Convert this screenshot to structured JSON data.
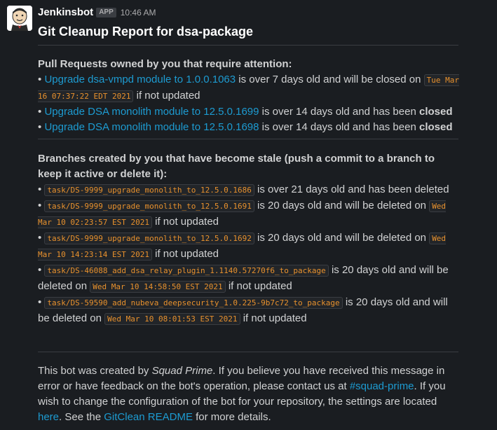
{
  "message": {
    "sender": "Jenkinsbot",
    "badge": "APP",
    "time": "10:46 AM",
    "title": "Git Cleanup Report for dsa-package"
  },
  "pull_requests": {
    "heading": "Pull Requests owned by you that require attention:",
    "items": [
      {
        "bullet": "•",
        "link": "Upgrade dsa-vmpd module to 1.0.0.1063",
        "text1": " is over 7 days old and will be closed on ",
        "date": "Tue Mar 16 07:37:22 EDT 2021",
        "text2": " if not updated"
      },
      {
        "bullet": "•",
        "link": "Upgrade DSA monolith module to 12.5.0.1699",
        "text1": " is over 14 days old and has been ",
        "bold": "closed"
      },
      {
        "bullet": "•",
        "link": "Upgrade DSA monolith module to 12.5.0.1698",
        "text1": " is over 14 days old and has been ",
        "bold": "closed"
      }
    ]
  },
  "branches": {
    "heading": "Branches created by you that have become stale (push a commit to a branch to keep it active or delete it):",
    "items": [
      {
        "bullet": "•",
        "branch": "task/DS-9999_upgrade_monolith_to_12.5.0.1686",
        "text1": " is over 21 days old and has been deleted"
      },
      {
        "bullet": "•",
        "branch": "task/DS-9999_upgrade_monolith_to_12.5.0.1691",
        "text1": " is 20 days old and will be deleted on ",
        "date": "Wed Mar 10 02:23:57 EST 2021",
        "text2": " if not updated"
      },
      {
        "bullet": "•",
        "branch": "task/DS-9999_upgrade_monolith_to_12.5.0.1692",
        "text1": " is 20 days old and will be deleted on ",
        "date": "Wed Mar 10 14:23:14 EST 2021",
        "text2": " if not updated"
      },
      {
        "bullet": "•",
        "branch": "task/DS-46088_add_dsa_relay_plugin_1.1140.57270f6_to_package",
        "text1": " is 20 days old and will be deleted on ",
        "date": "Wed Mar 10 14:58:50 EST 2021",
        "text2": " if not updated"
      },
      {
        "bullet": "•",
        "branch": "task/DS-59590_add_nubeva_deepsecurity_1.0.225-9b7c72_to_package",
        "text1": " is 20 days old and will be deleted on ",
        "date": "Wed Mar 10 08:01:53 EST 2021",
        "text2": " if not updated"
      }
    ]
  },
  "footer": {
    "t1": "This bot was created by ",
    "italic": "Squad Prime",
    "t2": ". If you believe you have received this message in error or have feedback on the bot's operation, please contact us at ",
    "channel": "#squad-prime",
    "t3": ". If you wish to change the configuration of the bot for your repository, the settings are located ",
    "here": "here",
    "t4": ". See the ",
    "readme": "GitClean README",
    "t5": " for more details."
  },
  "colors": {
    "background": "#1a1d21",
    "text": "#d1d2d3",
    "link": "#1d9bd1",
    "code": "#e8912d"
  }
}
